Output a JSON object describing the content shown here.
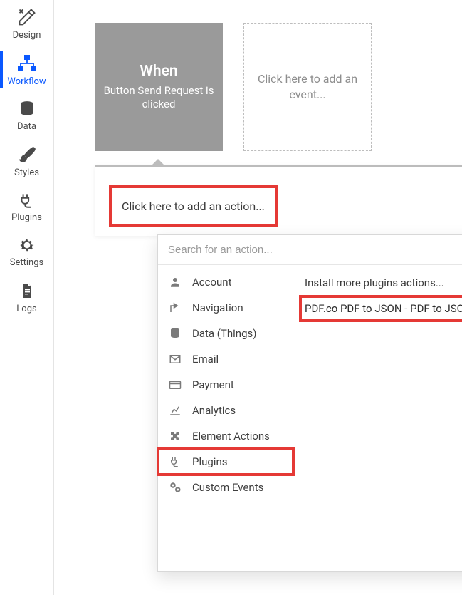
{
  "sidebar": {
    "items": [
      {
        "id": "design",
        "label": "Design"
      },
      {
        "id": "workflow",
        "label": "Workflow"
      },
      {
        "id": "data",
        "label": "Data"
      },
      {
        "id": "styles",
        "label": "Styles"
      },
      {
        "id": "plugins",
        "label": "Plugins"
      },
      {
        "id": "settings",
        "label": "Settings"
      },
      {
        "id": "logs",
        "label": "Logs"
      }
    ],
    "active_index": 1
  },
  "events": {
    "selected": {
      "when_label": "When",
      "description": "Button Send Request is clicked"
    },
    "add_prompt": "Click here to add an event..."
  },
  "action_panel": {
    "add_prompt": "Click here to add an action..."
  },
  "action_dropdown": {
    "search_placeholder": "Search for an action...",
    "categories": [
      {
        "id": "account",
        "label": "Account"
      },
      {
        "id": "navigation",
        "label": "Navigation"
      },
      {
        "id": "data",
        "label": "Data (Things)"
      },
      {
        "id": "email",
        "label": "Email"
      },
      {
        "id": "payment",
        "label": "Payment"
      },
      {
        "id": "analytics",
        "label": "Analytics"
      },
      {
        "id": "element",
        "label": "Element Actions"
      },
      {
        "id": "plugins",
        "label": "Plugins"
      },
      {
        "id": "custom",
        "label": "Custom Events"
      }
    ],
    "selected_category_index": 7,
    "results": {
      "install_more": "Install more plugins actions...",
      "items": [
        {
          "label": "PDF.co PDF to JSON - PDF to JSON"
        }
      ]
    }
  },
  "colors": {
    "accent": "#0a58ff",
    "highlight_box": "#e53935",
    "event_selected_bg": "#9a9a9a"
  }
}
